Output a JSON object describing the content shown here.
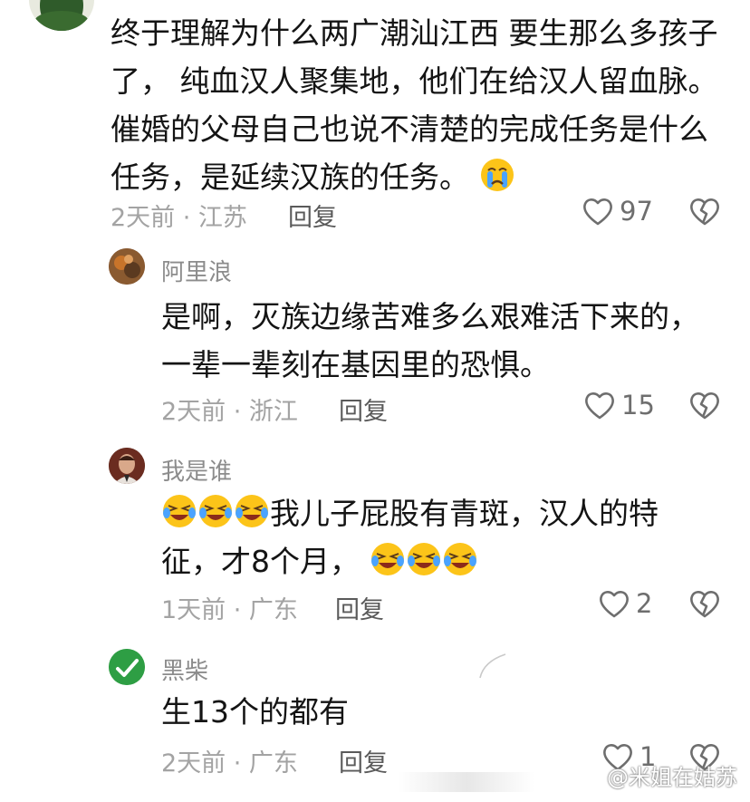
{
  "comments": [
    {
      "lines": [
        "终于理解为什么两广潮汕江西 要生那么多孩子",
        "了， 纯血汉人聚集地，他们在给汉人留血脉。",
        "催婚的父母自己也说不清楚的完成任务是什么",
        "任务，是延续汉族的任务。"
      ],
      "meta": "2天前 · 江苏",
      "reply": "回复",
      "likes": "97"
    },
    {
      "name": "阿里浪",
      "lines": [
        "是啊，灭族边缘苦难多么艰难活下来的，",
        "一辈一辈刻在基因里的恐惧。"
      ],
      "meta": "2天前 · 浙江",
      "reply": "回复",
      "likes": "15"
    },
    {
      "name": "我是谁",
      "line1": "我儿子屁股有青斑，汉人的特",
      "line2": "征，才8个月，",
      "meta": "1天前 · 广东",
      "reply": "回复",
      "likes": "2"
    },
    {
      "name": "黑柴",
      "lines": [
        "生13个的都有"
      ],
      "meta": "2天前 · 广东",
      "reply": "回复",
      "likes": "1"
    }
  ],
  "watermark": "@米姐在姑苏",
  "colors": {
    "name": "#8c8c8c",
    "meta": "#a3a3a3",
    "text": "#141414",
    "icon": "#6e6e6e"
  }
}
